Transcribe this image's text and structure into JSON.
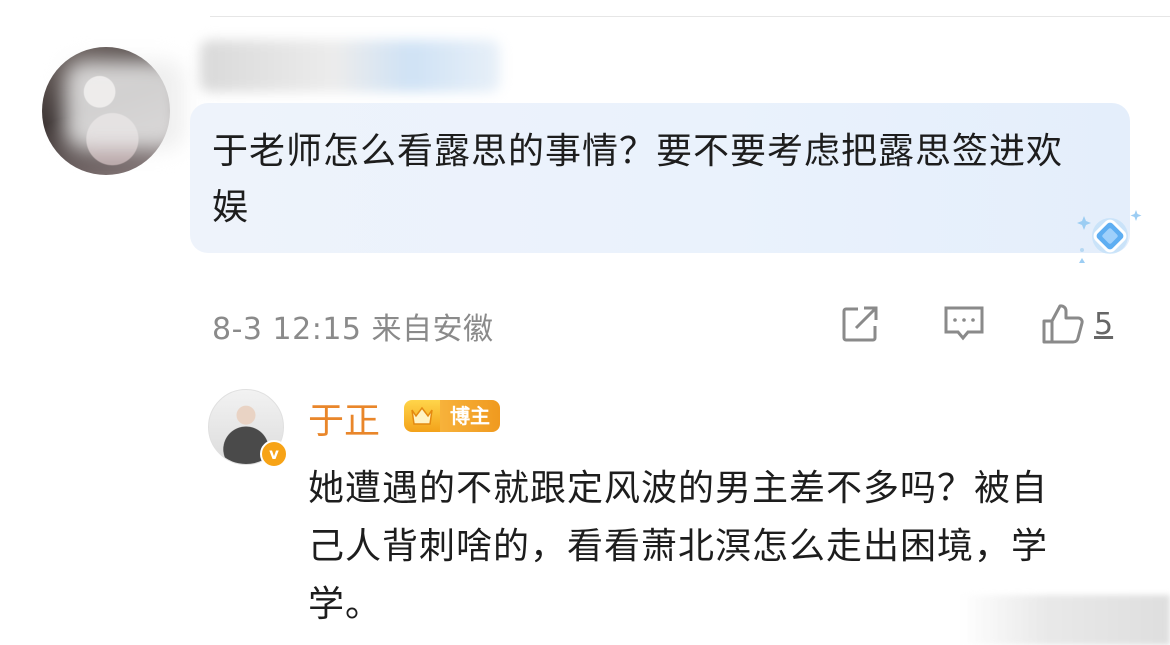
{
  "comment": {
    "text": "于老师怎么看露思的事情？要不要考虑把露思签进欢娱",
    "timestamp": "8-3 12:15",
    "location": "来自安徽",
    "like_count": "5"
  },
  "reply": {
    "author": "于正",
    "badge": "博主",
    "text": "她遭遇的不就跟定风波的男主差不多吗？被自己人背刺啥的，看看萧北溟怎么走出困境，学学。"
  },
  "icons": {
    "share": "share-icon",
    "comment": "comment-icon",
    "like": "thumbs-up-icon",
    "verified": "verified-v-icon"
  },
  "colors": {
    "author_name": "#e9862a",
    "badge": "#f3a21a",
    "bubble": "#eaf2fc"
  }
}
